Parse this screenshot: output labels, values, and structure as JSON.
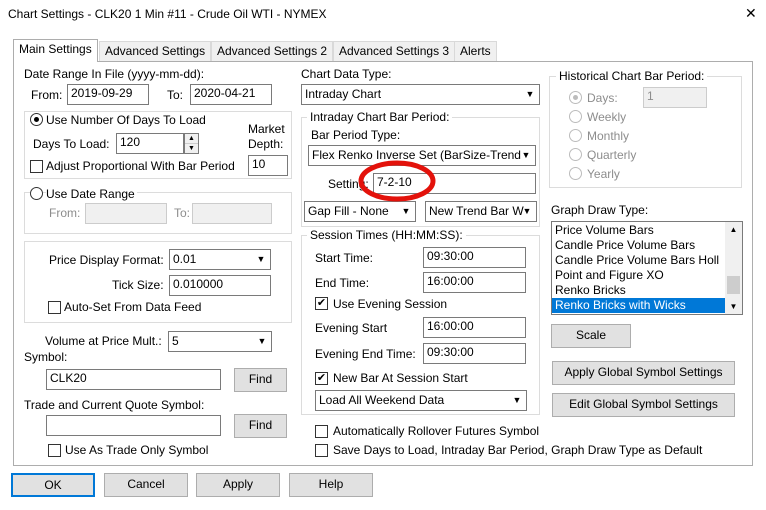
{
  "window": {
    "title": "Chart Settings - CLK20  1 Min  #11 - Crude Oil WTI - NYMEX",
    "close_glyph": "✕"
  },
  "tabs": [
    "Main Settings",
    "Advanced Settings",
    "Advanced Settings 2",
    "Advanced Settings 3",
    "Alerts"
  ],
  "date_range": {
    "label": "Date Range In File (yyyy-mm-dd):",
    "from_label": "From:",
    "from_value": "2019-09-29",
    "to_label": "To:",
    "to_value": "2020-04-21"
  },
  "days_group": {
    "radio_label": "Use Number Of Days To Load",
    "days_label": "Days To Load:",
    "days_value": "120",
    "market_depth_label_1": "Market",
    "market_depth_label_2": "Depth:",
    "market_depth_value": "10",
    "adjust_label": "Adjust Proportional With Bar Period"
  },
  "date_range_group": {
    "radio_label": "Use Date Range",
    "from_label": "From:",
    "to_label": "To:"
  },
  "price_group": {
    "format_label": "Price Display Format:",
    "format_value": "0.01",
    "tick_label": "Tick Size:",
    "tick_value": "0.010000",
    "autoset_label": "Auto-Set From Data Feed"
  },
  "volume": {
    "label": "Volume at Price Mult.:",
    "value": "5"
  },
  "symbol": {
    "label": "Symbol:",
    "value": "CLK20",
    "find_label": "Find"
  },
  "trade_symbol": {
    "label": "Trade and Current Quote Symbol:",
    "value": "",
    "find_label": "Find",
    "use_as_trade_only_label": "Use As Trade Only Symbol"
  },
  "chart_data_type": {
    "label": "Chart Data Type:",
    "value": "Intraday Chart"
  },
  "intraday_bar": {
    "group_label": "Intraday Chart Bar Period:",
    "type_label": "Bar Period Type:",
    "type_value": "Flex Renko Inverse Set (BarSize-Trend",
    "setting_label": "Setting:",
    "setting_value": "7-2-10",
    "gap_fill_value": "Gap Fill - None",
    "new_trend_value": "New Trend Bar W"
  },
  "session": {
    "group_label": "Session Times (HH:MM:SS):",
    "start_label": "Start Time:",
    "start_value": "09:30:00",
    "end_label": "End Time:",
    "end_value": "16:00:00",
    "evening_label": "Use Evening Session",
    "evening_start_label": "Evening Start",
    "evening_start_value": "16:00:00",
    "evening_end_label": "Evening End Time:",
    "evening_end_value": "09:30:00",
    "new_bar_label": "New Bar At Session Start",
    "weekend_value": "Load All Weekend Data"
  },
  "historical": {
    "group_label": "Historical Chart Bar Period:",
    "days_label": "Days:",
    "days_value": "1",
    "weekly_label": "Weekly",
    "monthly_label": "Monthly",
    "quarterly_label": "Quarterly",
    "yearly_label": "Yearly"
  },
  "graph_draw": {
    "label": "Graph Draw Type:",
    "items": [
      "Price Volume Bars",
      "Candle Price Volume Bars",
      "Candle Price Volume Bars Holl",
      "Point and Figure XO",
      "Renko Bricks",
      "Renko Bricks with Wicks"
    ],
    "selected_index": 5
  },
  "buttons": {
    "scale": "Scale",
    "apply_global": "Apply Global Symbol Settings",
    "edit_global": "Edit Global Symbol Settings",
    "ok": "OK",
    "cancel": "Cancel",
    "apply": "Apply",
    "help": "Help"
  },
  "rollover_label": "Automatically Rollover Futures Symbol",
  "save_default_label": "Save Days to Load, Intraday Bar Period, Graph Draw Type as Default",
  "colors": {
    "selection": "#0078d7",
    "annotation_circle": "#e3120b",
    "disabled_text": "#8d8d8d"
  }
}
